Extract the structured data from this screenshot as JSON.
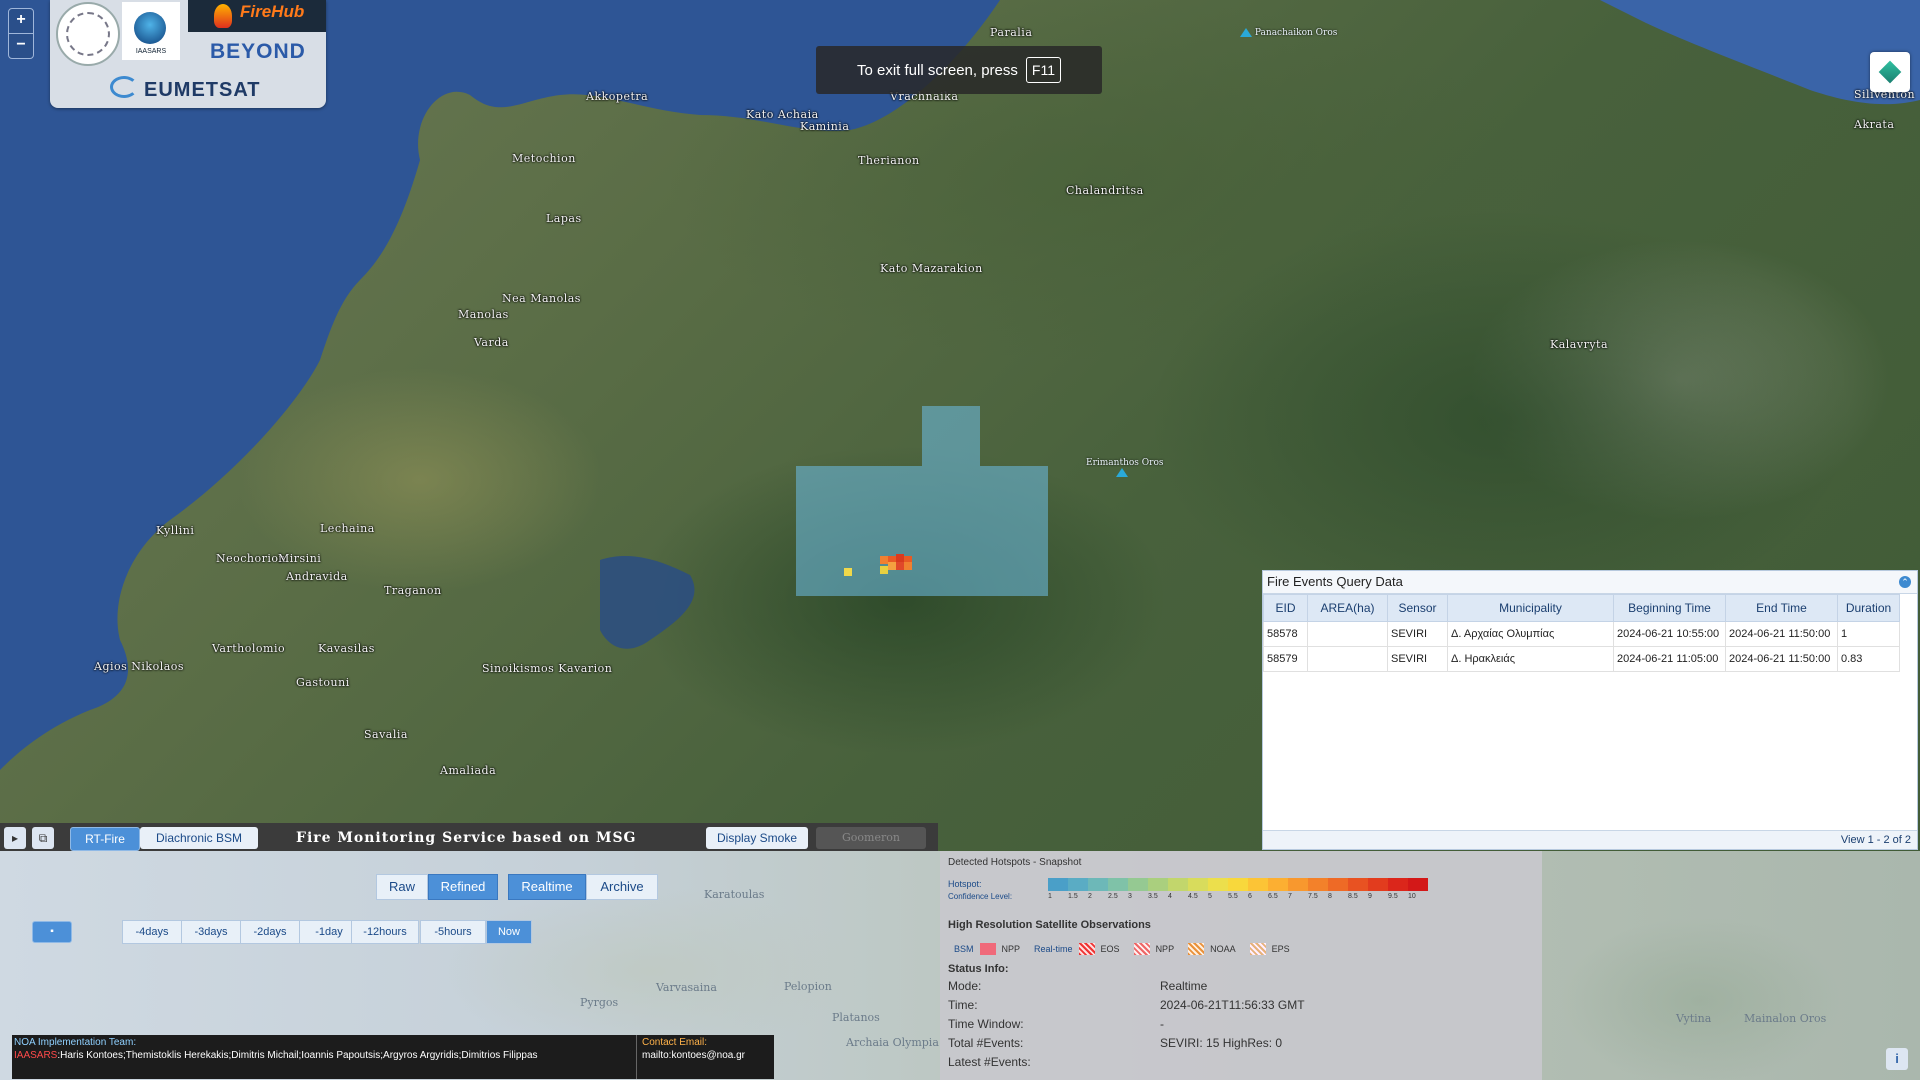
{
  "map": {
    "places": [
      {
        "name": "Paralia"
      },
      {
        "name": "Akkopetra"
      },
      {
        "name": "Kato Achaia"
      },
      {
        "name": "Kaminia"
      },
      {
        "name": "Vrachnaika"
      },
      {
        "name": "Metochion"
      },
      {
        "name": "Therianon"
      },
      {
        "name": "Chalandritsa"
      },
      {
        "name": "Lapas"
      },
      {
        "name": "Kato Mazarakion"
      },
      {
        "name": "Nea Manolas"
      },
      {
        "name": "Manolas"
      },
      {
        "name": "Varda"
      },
      {
        "name": "Kalavryta"
      },
      {
        "name": "Kyllini"
      },
      {
        "name": "Lechaina"
      },
      {
        "name": "Neochorion"
      },
      {
        "name": "Mirsini"
      },
      {
        "name": "Andravida"
      },
      {
        "name": "Traganon"
      },
      {
        "name": "Vartholomio"
      },
      {
        "name": "Kavasilas"
      },
      {
        "name": "Agios Nikolaos"
      },
      {
        "name": "Gastouni"
      },
      {
        "name": "Sinoikismos Kavarion"
      },
      {
        "name": "Savalia"
      },
      {
        "name": "Amaliada"
      },
      {
        "name": "Akrata"
      },
      {
        "name": "Siliventon"
      }
    ],
    "peaks": [
      "Panachaikon Oros",
      "Erimanthos Oros"
    ],
    "zoom_in": "+",
    "zoom_out": "−"
  },
  "logos": {
    "iaasars": "IAASARS",
    "firehub": "FireHub",
    "beyond": "BEYOND",
    "eumetsat": "EUMETSAT"
  },
  "fullscreen": {
    "text": "To exit full screen, press",
    "key": "F11"
  },
  "query": {
    "title": "Fire Events Query Data",
    "columns": [
      "EID",
      "AREA(ha)",
      "Sensor",
      "Municipality",
      "Beginning Time",
      "End Time",
      "Duration"
    ],
    "rows": [
      [
        "58578",
        "",
        "SEVIRI",
        "Δ. Αρχαίας Ολυμπίας",
        "2024-06-21 10:55:00",
        "2024-06-21 11:50:00",
        "1"
      ],
      [
        "58579",
        "",
        "SEVIRI",
        "Δ. Ηρακλειάς",
        "2024-06-21 11:05:00",
        "2024-06-21 11:50:00",
        "0.83"
      ]
    ],
    "footer": "View 1 - 2 of 2"
  },
  "toolbar": {
    "rt_fire": "RT-Fire",
    "diachronic": "Diachronic BSM",
    "title": "Fire Monitoring Service based on MSG SEVIRI",
    "smoke": "Display Smoke",
    "goomeron": "Goomeron"
  },
  "modes": {
    "raw": "Raw",
    "refined": "Refined",
    "realtime": "Realtime",
    "archive": "Archive"
  },
  "time_steps": [
    "-4days",
    "-3days",
    "-2days",
    "-1day",
    "-12hours",
    "-5hours",
    "Now"
  ],
  "bottom_places": [
    "Karatoulas",
    "Varvasaina",
    "Pelopion",
    "Pyrgos",
    "Platanos",
    "Archaia Olympia",
    "Vytina",
    "Mainalon Oros"
  ],
  "team": {
    "heading": "NOA Implementation Team:",
    "org": "IAASARS",
    "names": ":Haris Kontoes;Themistoklis Herekakis;Dimitris Michail;Ioannis Papoutsis;Argyros Argyridis;Dimitrios Filippas",
    "contact_heading": "Contact Email:",
    "contact": "mailto:kontoes@noa.gr"
  },
  "legend": {
    "title": "Detected Hotspots - Snapshot",
    "hotspot": "Hotspot:",
    "confidence": "Confidence Level:",
    "levels": [
      "1",
      "1.5",
      "2",
      "2.5",
      "3",
      "3.5",
      "4",
      "4.5",
      "5",
      "5.5",
      "6",
      "6.5",
      "7",
      "7.5",
      "8",
      "8.5",
      "9",
      "9.5",
      "10"
    ],
    "colors": [
      "#4a9fc8",
      "#5aacc4",
      "#6db8b8",
      "#7fc2a8",
      "#95c992",
      "#aacf7e",
      "#c2d66c",
      "#d8dc5c",
      "#ecdf4c",
      "#f8d83c",
      "#fcc436",
      "#fcaf32",
      "#f8982e",
      "#f3812a",
      "#ee6a26",
      "#e85222",
      "#e23c1e",
      "#db261b",
      "#d31818"
    ],
    "hr_title": "High Resolution Satellite Observations",
    "bsm": "BSM",
    "npp": "NPP",
    "realtime": "Real-time",
    "eos": "EOS",
    "npp2": "NPP",
    "noaa": "NOAA",
    "eps": "EPS"
  },
  "status": {
    "title": "Status Info:",
    "rows": [
      [
        "Mode:",
        "Realtime"
      ],
      [
        "Time:",
        "2024-06-21T11:56:33 GMT"
      ],
      [
        "Time Window:",
        "-"
      ],
      [
        "Total #Events:",
        "SEVIRI: 15  HighRes: 0"
      ],
      [
        "Latest #Events:",
        ""
      ]
    ]
  }
}
